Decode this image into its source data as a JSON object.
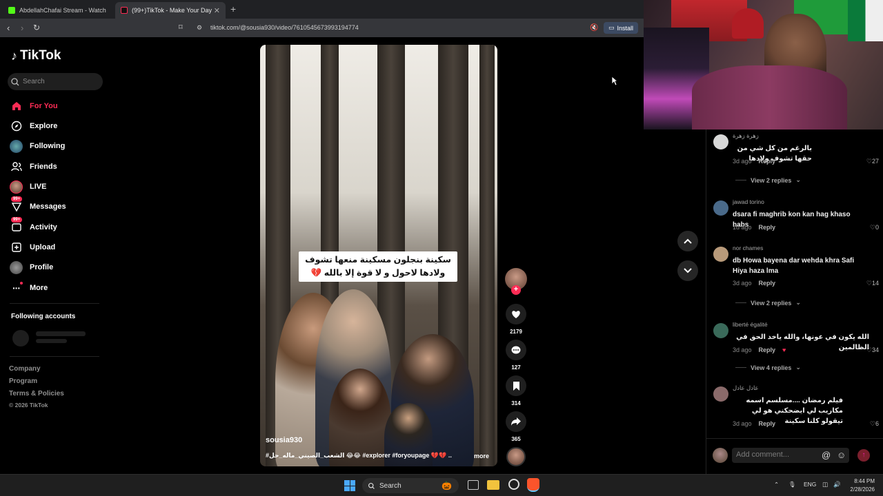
{
  "browser": {
    "tabs": [
      {
        "title": "AbdellahChafai Stream - Watch Live :",
        "active": false
      },
      {
        "title": "(99+)TikTok - Make Your Day",
        "active": true
      }
    ],
    "url": "tiktok.com/@sousia930/video/7610545673993194774",
    "install_label": "Install"
  },
  "sidebar": {
    "logo": "TikTok",
    "search_placeholder": "Search",
    "items": [
      {
        "label": "For You",
        "icon": "home-icon",
        "active": true
      },
      {
        "label": "Explore",
        "icon": "compass-icon"
      },
      {
        "label": "Following",
        "icon": "following-avatar-icon"
      },
      {
        "label": "Friends",
        "icon": "friends-icon"
      },
      {
        "label": "LIVE",
        "icon": "live-avatar-icon"
      },
      {
        "label": "Messages",
        "icon": "messages-icon",
        "badge": "99+"
      },
      {
        "label": "Activity",
        "icon": "activity-icon",
        "badge": "99+"
      },
      {
        "label": "Upload",
        "icon": "upload-icon"
      },
      {
        "label": "Profile",
        "icon": "profile-avatar-icon"
      },
      {
        "label": "More",
        "icon": "more-icon"
      }
    ],
    "following_accounts_title": "Following accounts",
    "footer": [
      "Company",
      "Program",
      "Terms & Policies",
      "© 2026 TikTok"
    ]
  },
  "video": {
    "caption_line1": "سكينة بنجلون مسكينة منعها تشوف",
    "caption_line2": "ولادها لاحول و لا قوة إلا بالله 💔",
    "username": "sousia930",
    "tags": "#الشعب_الصيني_ماله_حل 😂😂 #explorer #foryoupage 💔💔 ...",
    "more_label": "more"
  },
  "actions": {
    "likes": "2179",
    "comments": "127",
    "saves": "314",
    "shares": "365"
  },
  "comments": [
    {
      "user": "زهرة زهرة",
      "text": "بالرغم من كل شي من حقها تشوف ولادها",
      "age": "3d ago",
      "reply": "Reply",
      "likes": "27",
      "replies": "View 2 replies",
      "av": "#d8d8d8"
    },
    {
      "user": "jawad torino",
      "text": "dsara fi maghrib kon kan hag khaso habs",
      "age": "1d ago",
      "reply": "Reply",
      "likes": "0",
      "replies": "",
      "av": "#4a6a8a"
    },
    {
      "user": "nor chames",
      "text": "db Howa bayena dar wehda khra Safi Hiya haza lma",
      "age": "3d ago",
      "reply": "Reply",
      "likes": "14",
      "replies": "View 2 replies",
      "av": "#b89a7a"
    },
    {
      "user": "liberté égalité",
      "text": "الله يكون في عونها، والله ياخد الحق في الظالمين",
      "age": "3d ago",
      "reply": "Reply",
      "likes": "34",
      "replies": "View 4 replies",
      "av": "#3a6a5a"
    },
    {
      "user": "عادل عادل",
      "text": "فيلم رمضان ....مسلسم اسمه مكاريب لي ايضحكني هو لي تيقولو كلنا سكينة",
      "age": "3d ago",
      "reply": "Reply",
      "likes": "6",
      "replies": "",
      "av": "#8a6a6a"
    }
  ],
  "add_comment_placeholder": "Add comment...",
  "taskbar": {
    "search": "Search",
    "lang": "ENG",
    "time": "8:44 PM",
    "date": "2/28/2026"
  }
}
